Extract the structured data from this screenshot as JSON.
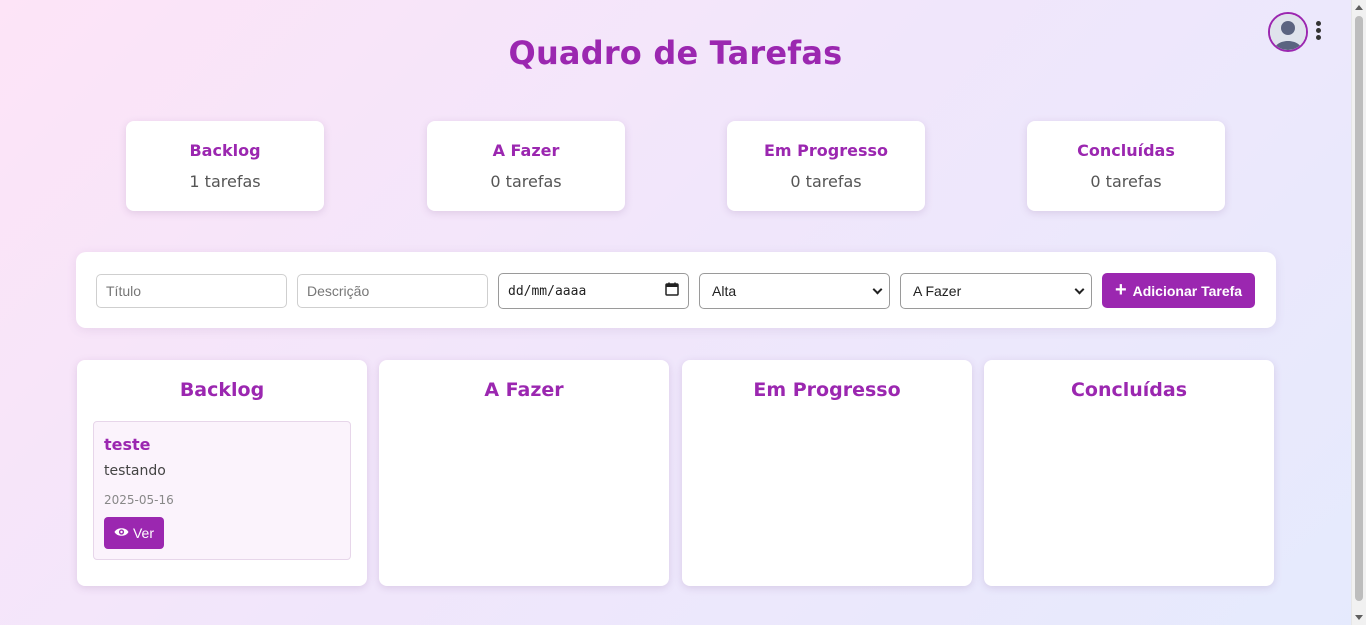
{
  "header": {
    "title": "Quadro de Tarefas",
    "avatar_icon": "user-avatar-icon",
    "menu_icon": "kebab-menu-icon"
  },
  "stats": [
    {
      "label": "Backlog",
      "count": "1 tarefas"
    },
    {
      "label": "A Fazer",
      "count": "0 tarefas"
    },
    {
      "label": "Em Progresso",
      "count": "0 tarefas"
    },
    {
      "label": "Concluídas",
      "count": "0 tarefas"
    }
  ],
  "form": {
    "title_placeholder": "Título",
    "description_placeholder": "Descrição",
    "date_value": "dd/mm/aaaa",
    "priority_value": "Alta",
    "status_value": "A Fazer",
    "add_button_label": "Adicionar Tarefa"
  },
  "columns": [
    {
      "title": "Backlog",
      "tasks": [
        {
          "title": "teste",
          "description": "testando",
          "date": "2025-05-16",
          "view_label": "Ver"
        }
      ]
    },
    {
      "title": "A Fazer",
      "tasks": []
    },
    {
      "title": "Em Progresso",
      "tasks": []
    },
    {
      "title": "Concluídas",
      "tasks": []
    }
  ],
  "colors": {
    "accent": "#9b27b0",
    "card_background": "#ffffff",
    "task_background": "#fbf3fc"
  }
}
